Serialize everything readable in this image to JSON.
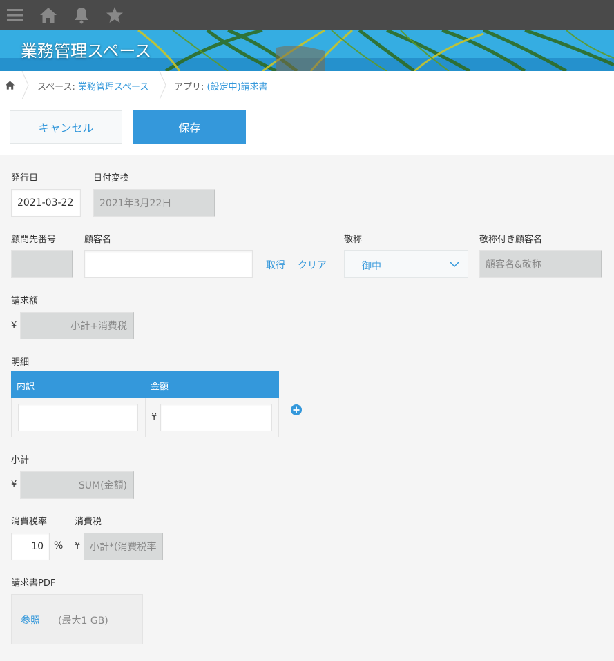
{
  "header": {
    "space_title": "業務管理スペース"
  },
  "breadcrumb": {
    "space_prefix": "スペース: ",
    "space_link": "業務管理スペース",
    "app_prefix": "アプリ: ",
    "app_link": "(設定中)請求書"
  },
  "toolbar": {
    "cancel_label": "キャンセル",
    "save_label": "保存"
  },
  "form": {
    "issue_date_label": "発行日",
    "issue_date_value": "2021-03-22",
    "date_convert_label": "日付変換",
    "date_convert_value": "2021年3月22日",
    "customer_no_label": "顧問先番号",
    "customer_no_value": "",
    "customer_name_label": "顧客名",
    "customer_name_value": "",
    "fetch_label": "取得",
    "clear_label": "クリア",
    "honorific_label": "敬称",
    "honorific_value": "御中",
    "customer_with_honorific_label": "敬称付き顧客名",
    "customer_with_honorific_value": "顧客名&敬称",
    "billing_amount_label": "請求額",
    "billing_amount_value": "小計+消費税",
    "currency_symbol": "¥",
    "details_label": "明細",
    "details_columns": [
      "内訳",
      "金額"
    ],
    "subtotal_label": "小計",
    "subtotal_value": "SUM(金額)",
    "tax_rate_label": "消費税率",
    "tax_rate_value": "10",
    "percent_symbol": "%",
    "tax_label": "消費税",
    "tax_value": "小計*(消費税率",
    "pdf_label": "請求書PDF",
    "browse_label": "参照",
    "max_size_label": "(最大1 GB)"
  },
  "colors": {
    "topbar": "#4a4a4a",
    "accent": "#3498db",
    "calc_field": "#d8dada",
    "background": "#f5f5f5"
  }
}
